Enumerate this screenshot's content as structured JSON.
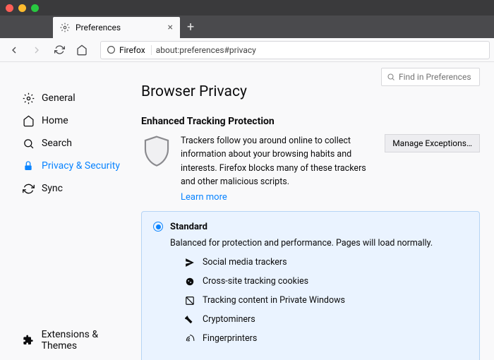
{
  "window": {
    "tab_title": "Preferences"
  },
  "urlbar": {
    "identity": "Firefox",
    "url": "about:preferences#privacy"
  },
  "search": {
    "placeholder": "Find in Preferences"
  },
  "sidebar": {
    "categories": [
      {
        "label": "General"
      },
      {
        "label": "Home"
      },
      {
        "label": "Search"
      },
      {
        "label": "Privacy & Security"
      },
      {
        "label": "Sync"
      }
    ],
    "footer": {
      "label": "Extensions & Themes"
    }
  },
  "main": {
    "heading": "Browser Privacy",
    "etp": {
      "title": "Enhanced Tracking Protection",
      "desc": "Trackers follow you around online to collect information about your browsing habits and interests. Firefox blocks many of these trackers and other malicious scripts.",
      "learn": "Learn more",
      "manage_btn": "Manage Exceptions…"
    },
    "standard": {
      "title": "Standard",
      "sub": "Balanced for protection and performance. Pages will load normally.",
      "items": [
        "Social media trackers",
        "Cross-site tracking cookies",
        "Tracking content in Private Windows",
        "Cryptominers",
        "Fingerprinters"
      ]
    }
  }
}
